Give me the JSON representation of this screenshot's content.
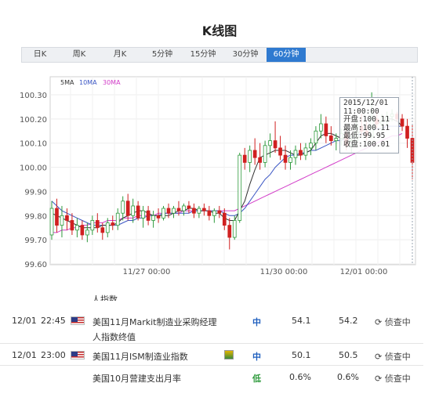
{
  "page": {
    "title": "K线图"
  },
  "tabs": [
    "日K",
    "周K",
    "月K",
    "5分钟",
    "15分钟",
    "30分钟",
    "60分钟"
  ],
  "active_tab": 6,
  "chart_data": {
    "type": "candlestick",
    "legend": [
      {
        "name": "5MA",
        "color": "#333333"
      },
      {
        "name": "10MA",
        "color": "#3b56c4"
      },
      {
        "name": "30MA",
        "color": "#d23cc8"
      }
    ],
    "y_ticks": [
      "100.30",
      "100.20",
      "100.10",
      "100.00",
      "99.90",
      "99.80",
      "99.70",
      "99.60"
    ],
    "ylim": [
      99.6,
      100.3
    ],
    "x_labels": [
      "11/27 00:00",
      "11/30 00:00",
      "12/01 00:00"
    ],
    "up_color": "#2e9a3c",
    "down_color": "#d02020",
    "candles": [
      {
        "o": 99.72,
        "h": 99.86,
        "l": 99.7,
        "c": 99.83
      },
      {
        "o": 99.83,
        "h": 99.87,
        "l": 99.73,
        "c": 99.76
      },
      {
        "o": 99.76,
        "h": 99.84,
        "l": 99.71,
        "c": 99.8
      },
      {
        "o": 99.8,
        "h": 99.83,
        "l": 99.74,
        "c": 99.78
      },
      {
        "o": 99.78,
        "h": 99.81,
        "l": 99.72,
        "c": 99.74
      },
      {
        "o": 99.74,
        "h": 99.79,
        "l": 99.71,
        "c": 99.76
      },
      {
        "o": 99.76,
        "h": 99.78,
        "l": 99.7,
        "c": 99.72
      },
      {
        "o": 99.72,
        "h": 99.77,
        "l": 99.69,
        "c": 99.74
      },
      {
        "o": 99.74,
        "h": 99.8,
        "l": 99.72,
        "c": 99.78
      },
      {
        "o": 99.78,
        "h": 99.81,
        "l": 99.73,
        "c": 99.75
      },
      {
        "o": 99.75,
        "h": 99.77,
        "l": 99.7,
        "c": 99.73
      },
      {
        "o": 99.73,
        "h": 99.79,
        "l": 99.71,
        "c": 99.77
      },
      {
        "o": 99.77,
        "h": 99.8,
        "l": 99.74,
        "c": 99.76
      },
      {
        "o": 99.76,
        "h": 99.83,
        "l": 99.74,
        "c": 99.81
      },
      {
        "o": 99.81,
        "h": 99.88,
        "l": 99.78,
        "c": 99.86
      },
      {
        "o": 99.86,
        "h": 99.89,
        "l": 99.78,
        "c": 99.8
      },
      {
        "o": 99.8,
        "h": 99.87,
        "l": 99.77,
        "c": 99.84
      },
      {
        "o": 99.84,
        "h": 99.86,
        "l": 99.78,
        "c": 99.79
      },
      {
        "o": 99.79,
        "h": 99.84,
        "l": 99.75,
        "c": 99.82
      },
      {
        "o": 99.82,
        "h": 99.84,
        "l": 99.76,
        "c": 99.78
      },
      {
        "o": 99.78,
        "h": 99.82,
        "l": 99.75,
        "c": 99.8
      },
      {
        "o": 99.8,
        "h": 99.83,
        "l": 99.77,
        "c": 99.79
      },
      {
        "o": 99.79,
        "h": 99.84,
        "l": 99.78,
        "c": 99.83
      },
      {
        "o": 99.83,
        "h": 99.85,
        "l": 99.79,
        "c": 99.81
      },
      {
        "o": 99.81,
        "h": 99.84,
        "l": 99.79,
        "c": 99.83
      },
      {
        "o": 99.83,
        "h": 99.86,
        "l": 99.8,
        "c": 99.82
      },
      {
        "o": 99.82,
        "h": 99.85,
        "l": 99.8,
        "c": 99.84
      },
      {
        "o": 99.84,
        "h": 99.86,
        "l": 99.81,
        "c": 99.83
      },
      {
        "o": 99.83,
        "h": 99.85,
        "l": 99.79,
        "c": 99.81
      },
      {
        "o": 99.81,
        "h": 99.84,
        "l": 99.79,
        "c": 99.83
      },
      {
        "o": 99.83,
        "h": 99.85,
        "l": 99.8,
        "c": 99.82
      },
      {
        "o": 99.82,
        "h": 99.84,
        "l": 99.78,
        "c": 99.8
      },
      {
        "o": 99.8,
        "h": 99.83,
        "l": 99.77,
        "c": 99.82
      },
      {
        "o": 99.82,
        "h": 99.84,
        "l": 99.79,
        "c": 99.81
      },
      {
        "o": 99.81,
        "h": 99.83,
        "l": 99.74,
        "c": 99.76
      },
      {
        "o": 99.76,
        "h": 99.79,
        "l": 99.66,
        "c": 99.71
      },
      {
        "o": 99.71,
        "h": 99.8,
        "l": 99.7,
        "c": 99.78
      },
      {
        "o": 99.78,
        "h": 100.06,
        "l": 99.77,
        "c": 100.05
      },
      {
        "o": 100.05,
        "h": 100.08,
        "l": 99.99,
        "c": 100.02
      },
      {
        "o": 100.02,
        "h": 100.09,
        "l": 99.98,
        "c": 100.07
      },
      {
        "o": 100.07,
        "h": 100.12,
        "l": 100.01,
        "c": 100.04
      },
      {
        "o": 100.04,
        "h": 100.1,
        "l": 99.99,
        "c": 100.02
      },
      {
        "o": 100.02,
        "h": 100.11,
        "l": 100.0,
        "c": 100.09
      },
      {
        "o": 100.09,
        "h": 100.14,
        "l": 100.04,
        "c": 100.11
      },
      {
        "o": 100.11,
        "h": 100.19,
        "l": 100.06,
        "c": 100.08
      },
      {
        "o": 100.08,
        "h": 100.13,
        "l": 100.03,
        "c": 100.05
      },
      {
        "o": 100.05,
        "h": 100.09,
        "l": 99.99,
        "c": 100.02
      },
      {
        "o": 100.02,
        "h": 100.07,
        "l": 99.99,
        "c": 100.04
      },
      {
        "o": 100.04,
        "h": 100.09,
        "l": 100.01,
        "c": 100.07
      },
      {
        "o": 100.07,
        "h": 100.1,
        "l": 100.03,
        "c": 100.05
      },
      {
        "o": 100.05,
        "h": 100.1,
        "l": 100.03,
        "c": 100.08
      },
      {
        "o": 100.08,
        "h": 100.12,
        "l": 100.05,
        "c": 100.1
      },
      {
        "o": 100.1,
        "h": 100.17,
        "l": 100.07,
        "c": 100.15
      },
      {
        "o": 100.15,
        "h": 100.22,
        "l": 100.12,
        "c": 100.18
      },
      {
        "o": 100.18,
        "h": 100.21,
        "l": 100.1,
        "c": 100.13
      },
      {
        "o": 100.13,
        "h": 100.17,
        "l": 100.09,
        "c": 100.11
      },
      {
        "o": 100.11,
        "h": 100.14,
        "l": 100.07,
        "c": 100.12
      },
      {
        "o": 100.12,
        "h": 100.16,
        "l": 100.09,
        "c": 100.14
      },
      {
        "o": 100.14,
        "h": 100.17,
        "l": 100.07,
        "c": 100.09
      },
      {
        "o": 100.09,
        "h": 100.13,
        "l": 100.06,
        "c": 100.11
      },
      {
        "o": 100.11,
        "h": 100.2,
        "l": 100.08,
        "c": 100.17
      },
      {
        "o": 100.17,
        "h": 100.22,
        "l": 100.13,
        "c": 100.15
      },
      {
        "o": 100.15,
        "h": 100.19,
        "l": 100.11,
        "c": 100.13
      },
      {
        "o": 100.13,
        "h": 100.31,
        "l": 100.12,
        "c": 100.2
      },
      {
        "o": 100.2,
        "h": 100.23,
        "l": 100.16,
        "c": 100.18
      },
      {
        "o": 100.18,
        "h": 100.22,
        "l": 100.15,
        "c": 100.19
      },
      {
        "o": 100.19,
        "h": 100.23,
        "l": 100.17,
        "c": 100.21
      },
      {
        "o": 100.21,
        "h": 100.24,
        "l": 100.19,
        "c": 100.22
      },
      {
        "o": 100.22,
        "h": 100.23,
        "l": 100.19,
        "c": 100.2
      },
      {
        "o": 100.2,
        "h": 100.22,
        "l": 100.15,
        "c": 100.17
      },
      {
        "o": 100.17,
        "h": 100.2,
        "l": 100.08,
        "c": 100.12
      },
      {
        "o": 100.12,
        "h": 100.18,
        "l": 99.95,
        "c": 100.02
      }
    ],
    "ma5": [
      99.81,
      99.8,
      99.79,
      99.78,
      99.77,
      99.76,
      99.75,
      99.75,
      99.75,
      99.75,
      99.76,
      99.76,
      99.76,
      99.77,
      99.79,
      99.8,
      99.81,
      99.82,
      99.82,
      99.81,
      99.8,
      99.8,
      99.8,
      99.8,
      99.81,
      99.82,
      99.82,
      99.83,
      99.83,
      99.82,
      99.82,
      99.82,
      99.81,
      99.81,
      99.79,
      99.78,
      99.78,
      99.82,
      99.86,
      99.93,
      99.99,
      100.04,
      100.05,
      100.06,
      100.07,
      100.07,
      100.07,
      100.06,
      100.05,
      100.05,
      100.06,
      100.07,
      100.1,
      100.13,
      100.14,
      100.14,
      100.13,
      100.12,
      100.11,
      100.12,
      100.14,
      100.15,
      100.16,
      100.17,
      100.18,
      100.19,
      100.2,
      100.2,
      100.19,
      100.17
    ],
    "ma10": [
      99.86,
      99.84,
      99.82,
      99.81,
      99.8,
      99.79,
      99.78,
      99.77,
      99.76,
      99.76,
      99.76,
      99.76,
      99.76,
      99.76,
      99.77,
      99.78,
      99.78,
      99.79,
      99.79,
      99.8,
      99.8,
      99.8,
      99.81,
      99.81,
      99.81,
      99.81,
      99.81,
      99.81,
      99.82,
      99.82,
      99.82,
      99.82,
      99.82,
      99.82,
      99.81,
      99.8,
      99.8,
      99.81,
      99.83,
      99.86,
      99.89,
      99.92,
      99.95,
      99.97,
      100.0,
      100.02,
      100.04,
      100.05,
      100.05,
      100.06,
      100.06,
      100.07,
      100.07,
      100.08,
      100.09,
      100.1,
      100.11,
      100.11,
      100.12,
      100.12,
      100.13,
      100.14,
      100.14,
      100.15,
      100.16,
      100.16,
      100.17,
      100.17,
      100.17,
      100.17
    ],
    "ma30": [
      99.73,
      99.73,
      99.74,
      99.74,
      99.75,
      99.75,
      99.76,
      99.76,
      99.77,
      99.77,
      99.77,
      99.78,
      99.78,
      99.78,
      99.79,
      99.79,
      99.79,
      99.8,
      99.8,
      99.8,
      99.8,
      99.81,
      99.81,
      99.81,
      99.81,
      99.81,
      99.82,
      99.82,
      99.82,
      99.82,
      99.82,
      99.82,
      99.82,
      99.82,
      99.82,
      99.82,
      99.82,
      99.83,
      99.84,
      99.85,
      99.86,
      99.87,
      99.88,
      99.89,
      99.9,
      99.91,
      99.92,
      99.93,
      99.94,
      99.95,
      99.96,
      99.97,
      99.98,
      99.99,
      100.0,
      100.01,
      100.02,
      100.03,
      100.04,
      100.05,
      100.06,
      100.07,
      100.08,
      100.09,
      100.1,
      100.11,
      100.12,
      100.13,
      100.13,
      100.14
    ],
    "tooltip": {
      "datetime": "2015/12/01",
      "time": "11:00:00",
      "open_label": "开盘",
      "open": "100.11",
      "high_label": "最高",
      "high": "100.11",
      "low_label": "最低",
      "low": "99.95",
      "close_label": "收盘",
      "close": "100.01"
    }
  },
  "events": {
    "partial_text": "人指数",
    "rows": [
      {
        "date": "12/01",
        "time": "22:45",
        "flag": "us-flag-icon",
        "title_line1": "美国11月Markit制造业采购经理",
        "title_line2": "人指数终值",
        "importance": "中",
        "previous": "54.1",
        "forecast": "54.2",
        "action": "侦查中"
      },
      {
        "date": "12/01",
        "time": "23:00",
        "flag": "us-flag-icon",
        "title_line1": "美国11月ISM制造业指数",
        "importance": "中",
        "previous": "50.1",
        "forecast": "50.5",
        "action": "侦查中"
      },
      {
        "date": "",
        "time": "",
        "title_line1": "美国10月营建支出月率",
        "importance": "低",
        "previous": "0.6%",
        "forecast": "0.6%",
        "action": "侦查中"
      }
    ]
  }
}
